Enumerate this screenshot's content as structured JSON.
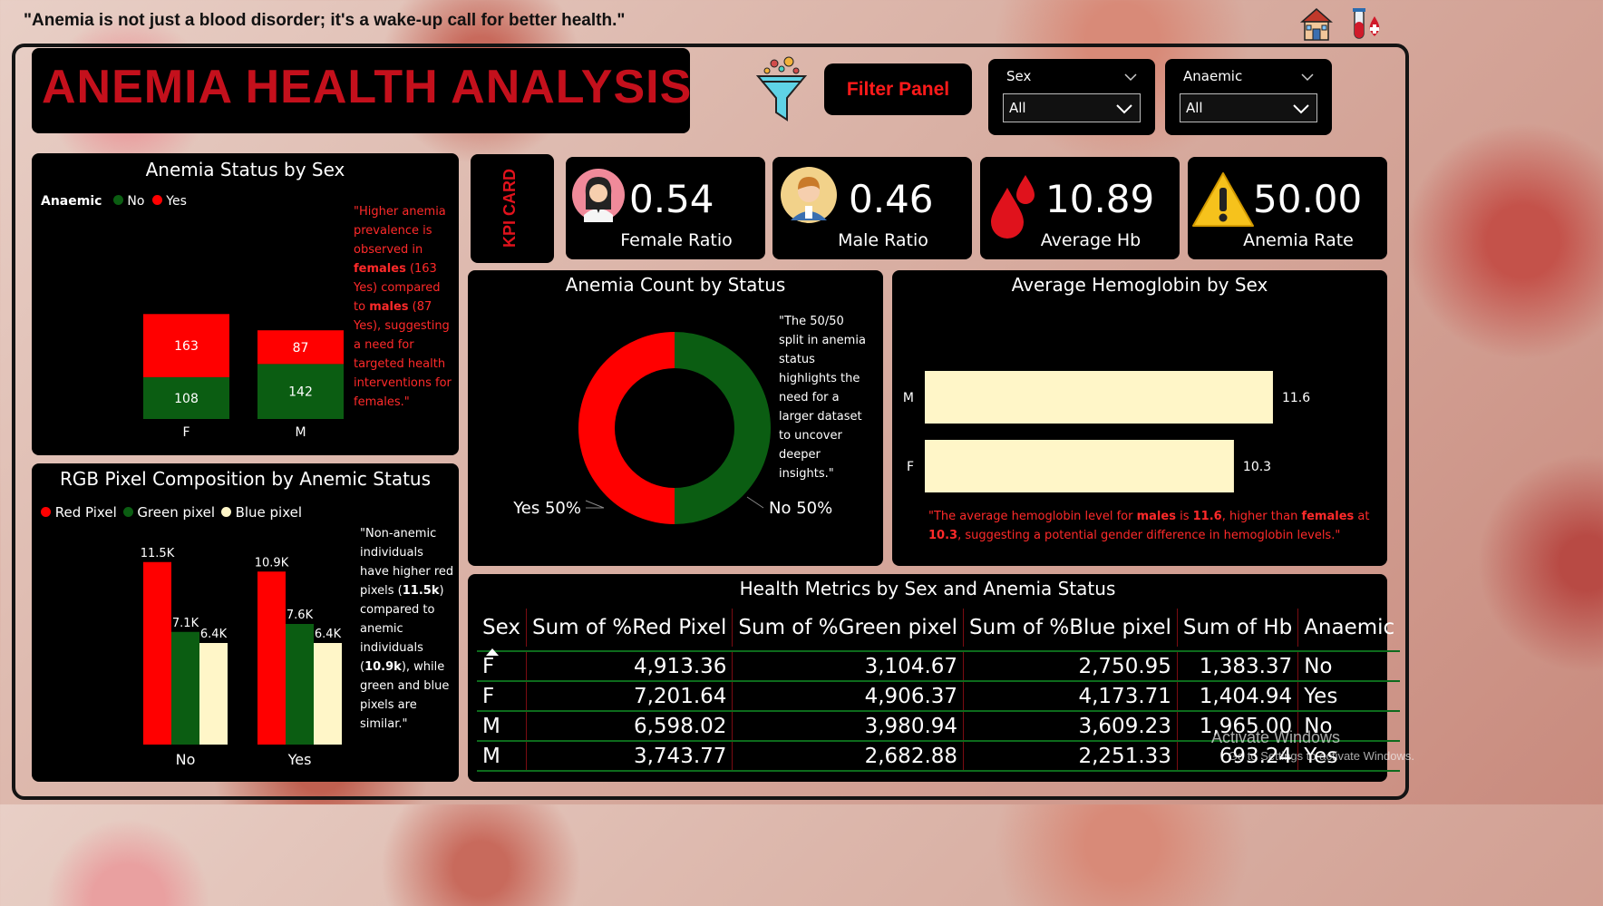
{
  "header": {
    "quote": "\"Anemia is not just a blood disorder; it's a wake-up call for better health.\"",
    "home_icon": "home-icon",
    "test_tube_icon": "blood-test-icon"
  },
  "title": "ANEMIA HEALTH ANALYSIS",
  "filter": {
    "icon": "funnel-icon",
    "button_label": "Filter Panel",
    "sex_label": "Sex",
    "sex_value": "All",
    "anaemic_label": "Anaemic",
    "anaemic_value": "All"
  },
  "kpi": {
    "card_label": "KPI CARD",
    "female_ratio": {
      "value": "0.54",
      "label": "Female Ratio"
    },
    "male_ratio": {
      "value": "0.46",
      "label": "Male Ratio"
    },
    "average_hb": {
      "value": "10.89",
      "label": "Average Hb"
    },
    "anemia_rate": {
      "value": "50.00",
      "label": "Anemia Rate"
    }
  },
  "colors": {
    "no": "#0b5d12",
    "yes": "#ff0000",
    "red": "#ff0000",
    "green": "#0b5d12",
    "blue": "#fff6c8",
    "hb_bar": "#fff6c8",
    "accent": "#c4101c"
  },
  "status_by_sex": {
    "title": "Anemia Status by Sex",
    "legend_title": "Anaemic",
    "legend_no": "No",
    "legend_yes": "Yes",
    "note_parts": [
      "\"Higher anemia prevalence is observed in ",
      "females",
      " (163 Yes) compared to ",
      "males",
      " (87 Yes), suggesting a need for targeted health interventions for females.\""
    ]
  },
  "count_by_status": {
    "title": "Anemia Count by Status",
    "yes_label": "Yes 50%",
    "no_label": "No 50%",
    "note": "\"The 50/50 split in anemia status highlights the need for a larger dataset to uncover deeper insights.\""
  },
  "hb_by_sex": {
    "title": "Average Hemoglobin by Sex",
    "note_parts": [
      "\"The average hemoglobin level for ",
      "males",
      " is ",
      "11.6",
      ", higher than ",
      "females",
      " at ",
      "10.3",
      ", suggesting a potential gender difference in hemoglobin levels.\""
    ]
  },
  "rgb": {
    "title": "RGB Pixel Composition by Anemic Status",
    "legend": [
      "Red Pixel",
      "Green pixel",
      "Blue pixel"
    ],
    "note_parts": [
      "\"Non-anemic individuals have higher red pixels (",
      "11.5k",
      ") compared to anemic individuals (",
      "10.9k",
      "), while green and blue pixels are similar.\""
    ]
  },
  "chart_data": [
    {
      "type": "bar",
      "stacked": true,
      "title": "Anemia Status by Sex",
      "categories": [
        "F",
        "M"
      ],
      "series": [
        {
          "name": "No",
          "values": [
            108,
            142
          ],
          "labels": [
            "108",
            "142"
          ]
        },
        {
          "name": "Yes",
          "values": [
            163,
            87
          ],
          "labels": [
            "163",
            "87"
          ]
        }
      ]
    },
    {
      "type": "pie",
      "donut": true,
      "title": "Anemia Count by Status",
      "categories": [
        "Yes",
        "No"
      ],
      "values": [
        50,
        50
      ]
    },
    {
      "type": "bar",
      "orientation": "horizontal",
      "title": "Average Hemoglobin by Sex",
      "categories": [
        "M",
        "F"
      ],
      "values": [
        11.6,
        10.3
      ],
      "labels": [
        "11.6",
        "10.3"
      ]
    },
    {
      "type": "bar",
      "title": "RGB Pixel Composition by Anemic Status",
      "categories": [
        "No",
        "Yes"
      ],
      "series": [
        {
          "name": "Red Pixel",
          "values": [
            11500,
            10900
          ],
          "labels": [
            "11.5K",
            "10.9K"
          ]
        },
        {
          "name": "Green pixel",
          "values": [
            7100,
            7600
          ],
          "labels": [
            "7.1K",
            "7.6K"
          ]
        },
        {
          "name": "Blue pixel",
          "values": [
            6400,
            6400
          ],
          "labels": [
            "6.4K",
            "6.4K"
          ]
        }
      ]
    }
  ],
  "metrics_table": {
    "title": "Health Metrics by Sex and Anemia Status",
    "columns": [
      "Sex",
      "Sum of %Red Pixel",
      "Sum of %Green pixel",
      "Sum of %Blue pixel",
      "Sum of Hb",
      "Anaemic"
    ],
    "rows": [
      [
        "F",
        "4,913.36",
        "3,104.67",
        "2,750.95",
        "1,383.37",
        "No"
      ],
      [
        "F",
        "7,201.64",
        "4,906.37",
        "4,173.71",
        "1,404.94",
        "Yes"
      ],
      [
        "M",
        "6,598.02",
        "3,980.94",
        "3,609.23",
        "1,965.00",
        "No"
      ],
      [
        "M",
        "3,743.77",
        "2,682.88",
        "2,251.33",
        "693.24",
        "Yes"
      ]
    ]
  },
  "watermark": {
    "line1": "Activate Windows",
    "line2": "Go to Settings to activate Windows."
  }
}
